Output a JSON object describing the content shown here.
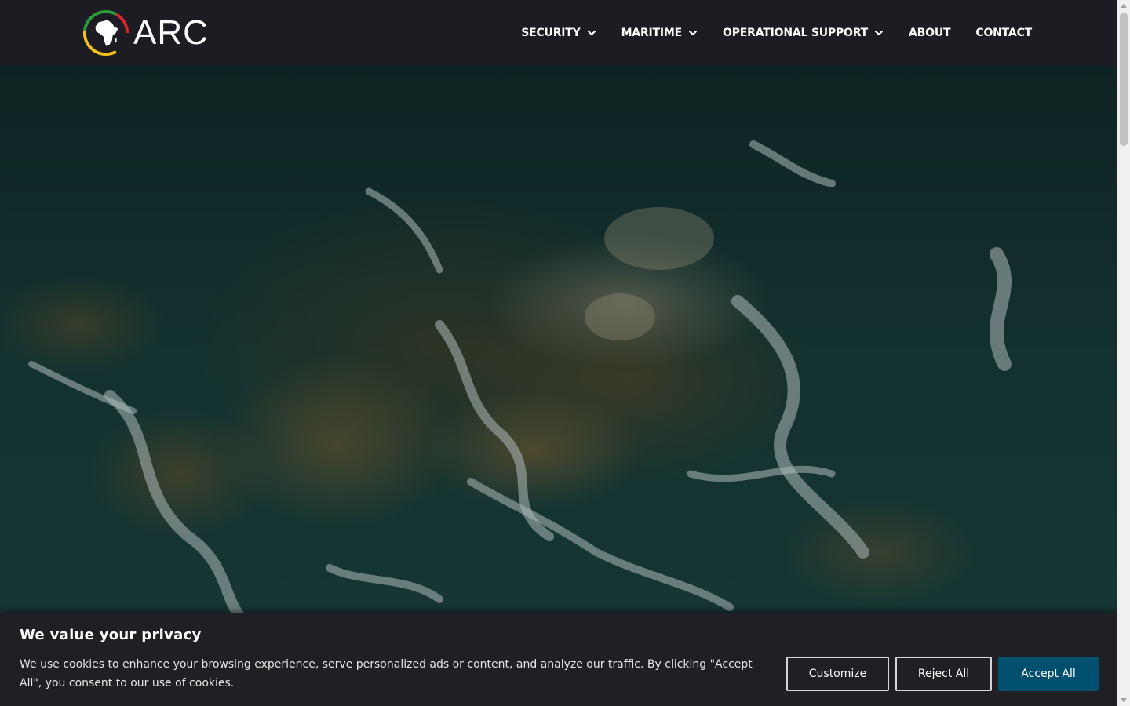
{
  "brand": {
    "name": "ARC",
    "ring_colors": [
      "#d8262d",
      "#f2c21a",
      "#2a9d3f"
    ]
  },
  "nav": {
    "items": [
      {
        "label": "SECURITY",
        "has_dropdown": true,
        "icon": "chevron-down-icon"
      },
      {
        "label": "MARITIME",
        "has_dropdown": true,
        "icon": "chevron-down-icon"
      },
      {
        "label": "OPERATIONAL SUPPORT",
        "has_dropdown": true,
        "icon": "chevron-down-icon"
      },
      {
        "label": "ABOUT",
        "has_dropdown": false
      },
      {
        "label": "CONTACT",
        "has_dropdown": false
      }
    ]
  },
  "hero": {
    "image_description_icon": "aerial-coastline-image"
  },
  "cookie_banner": {
    "title": "We value your privacy",
    "text": "We use cookies to enhance your browsing experience, serve personalized ads or content, and analyze our traffic. By clicking \"Accept All\", you consent to our use of cookies.",
    "buttons": {
      "customize": "Customize",
      "reject": "Reject All",
      "accept": "Accept All"
    },
    "accent_color": "#004f6e"
  }
}
